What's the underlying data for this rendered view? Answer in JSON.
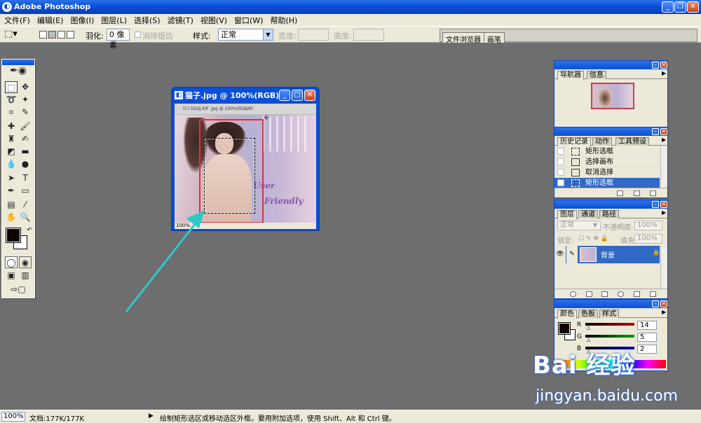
{
  "app": {
    "title": "Adobe Photoshop"
  },
  "menu": [
    "文件(F)",
    "编辑(E)",
    "图像(I)",
    "图层(L)",
    "选择(S)",
    "滤镜(T)",
    "视图(V)",
    "窗口(W)",
    "帮助(H)"
  ],
  "options": {
    "feather_label": "羽化:",
    "feather_value": "0 像素",
    "antialias_label": "消除锯齿",
    "style_label": "样式:",
    "style_value": "正常",
    "width_label": "宽度:",
    "height_label": "高度:",
    "well_tabs": [
      "文件浏览器",
      "画笔"
    ]
  },
  "document": {
    "title": "猫子.jpg @ 100%(RGB)",
    "inner_title": "(C) DSGJ.KIF .jpg @ 100%(RGB/8)",
    "zoom": "100%",
    "art_text_1": "User",
    "art_text_2": "Friendly"
  },
  "navigator": {
    "tabs": [
      "导航器",
      "信息"
    ]
  },
  "history": {
    "tabs": [
      "历史记录",
      "动作",
      "工具预设"
    ],
    "items": [
      "矩形选框",
      "选择画布",
      "取消选择",
      "矩形选框"
    ],
    "selected_index": 3
  },
  "layers": {
    "tabs": [
      "图层",
      "通道",
      "路径"
    ],
    "blend_mode": "正常",
    "opacity_label": "不透明度:",
    "opacity_value": "100%",
    "lock_label": "锁定:",
    "fill_label": "填充:",
    "fill_value": "100%",
    "layer_name": "背景"
  },
  "color": {
    "tabs": [
      "颜色",
      "色板",
      "样式"
    ],
    "channels": [
      {
        "label": "R",
        "value": "14",
        "color": "#c00000"
      },
      {
        "label": "G",
        "value": "5",
        "color": "#00a000"
      },
      {
        "label": "B",
        "value": "2",
        "color": "#0000c0"
      }
    ]
  },
  "status": {
    "zoom": "100%",
    "doc_size": "文档:177K/177K",
    "message": "绘制矩形选区或移动选区外框。要用附加选项，使用 Shift、Alt 和 Ctrl 键。"
  },
  "watermark": {
    "brand": "Bai 经验",
    "url": "jingyan.baidu.com"
  },
  "colors": {
    "accent": "#0a4fd8",
    "highlight_rect": "#e03040",
    "arrow": "#2ec8c8"
  }
}
